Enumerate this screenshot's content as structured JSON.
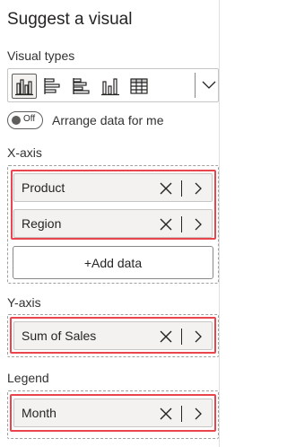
{
  "pane": {
    "title": "Suggest a visual"
  },
  "visual_types": {
    "label": "Visual types",
    "icons": [
      "clustered-column-chart-icon",
      "stacked-bar-chart-icon",
      "clustered-bar-chart-icon",
      "column-chart-icon",
      "table-icon"
    ],
    "selected": "clustered-column-chart-icon"
  },
  "arrange": {
    "toggle_text": "Off",
    "label": "Arrange data for me"
  },
  "x_axis": {
    "label": "X-axis",
    "fields": [
      "Product",
      "Region"
    ],
    "add_label": "+Add data"
  },
  "y_axis": {
    "label": "Y-axis",
    "fields": [
      "Sum of Sales"
    ]
  },
  "legend": {
    "label": "Legend",
    "fields": [
      "Month"
    ]
  },
  "colors": {
    "highlight": "#e8454d",
    "text": "#252423",
    "field_bg": "#f3f2f1"
  }
}
